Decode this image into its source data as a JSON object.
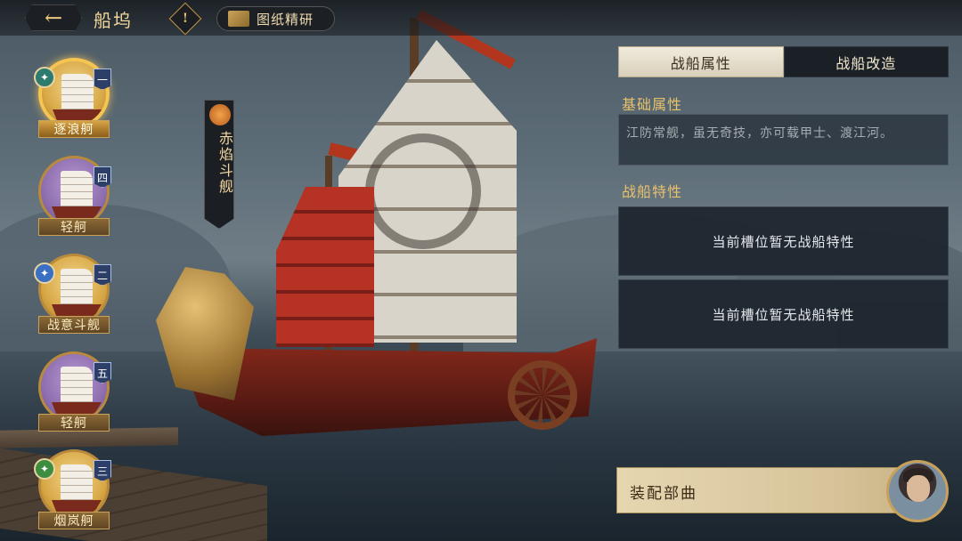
{
  "header": {
    "title": "船坞",
    "back_icon": "back-arrow-icon",
    "warn_glyph": "!",
    "blueprint_label": "图纸精研"
  },
  "ships": [
    {
      "name": "逐浪舸",
      "num": "一",
      "tier": "gold",
      "selected": true,
      "skill": "teal"
    },
    {
      "name": "轻舸",
      "num": "四",
      "tier": "purple",
      "selected": false,
      "skill": null
    },
    {
      "name": "战意斗舰",
      "num": "二",
      "tier": "gold",
      "selected": false,
      "skill": "blue"
    },
    {
      "name": "轻舸",
      "num": "五",
      "tier": "purple",
      "selected": false,
      "skill": null
    },
    {
      "name": "烟岚舸",
      "num": "三",
      "tier": "gold",
      "selected": false,
      "skill": "green"
    }
  ],
  "banner": {
    "text": "赤焰斗舰"
  },
  "tabs": [
    {
      "label": "战船属性",
      "active": true
    },
    {
      "label": "战船改造",
      "active": false
    }
  ],
  "base_section": {
    "title": "基础属性",
    "desc": "江防常舰，虽无奇技，亦可载甲士、渡江河。"
  },
  "trait_section": {
    "title": "战船特性",
    "slots": [
      "当前槽位暂无战船特性",
      "当前槽位暂无战船特性"
    ]
  },
  "equip": {
    "label": "装配部曲"
  },
  "colors": {
    "accent": "#e9c26c",
    "panel": "#1c242e",
    "gold": "#d8a846",
    "purple": "#8f6fb0"
  }
}
